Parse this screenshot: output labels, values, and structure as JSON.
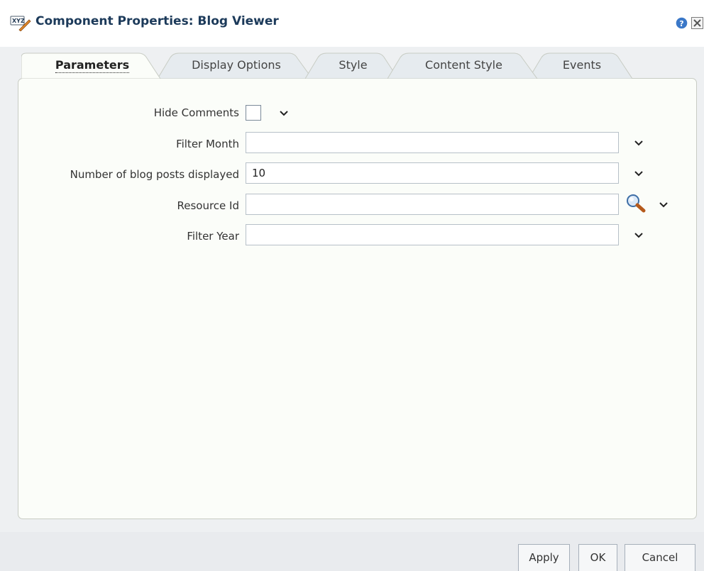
{
  "window": {
    "title": "Component Properties: Blog Viewer",
    "icons": [
      "xyz-wand-icon",
      "help-icon",
      "close-icon"
    ]
  },
  "tabs": [
    {
      "label": "Parameters",
      "active": true
    },
    {
      "label": "Display Options",
      "active": false
    },
    {
      "label": "Style",
      "active": false
    },
    {
      "label": "Content Style",
      "active": false
    },
    {
      "label": "Events",
      "active": false
    }
  ],
  "form": {
    "hide_comments": {
      "label": "Hide Comments",
      "checked": false
    },
    "filter_month": {
      "label": "Filter Month",
      "value": ""
    },
    "posts_displayed": {
      "label": "Number of blog posts displayed",
      "value": "10"
    },
    "resource_id": {
      "label": "Resource Id",
      "value": ""
    },
    "filter_year": {
      "label": "Filter Year",
      "value": ""
    }
  },
  "buttons": {
    "apply": "Apply",
    "ok": "OK",
    "cancel": "Cancel"
  },
  "colors": {
    "title": "#1c3a5a",
    "panel_bg": "#fbfdf9",
    "dialog_bg": "#eef0f2",
    "tab_bg": "#e6ebef"
  }
}
